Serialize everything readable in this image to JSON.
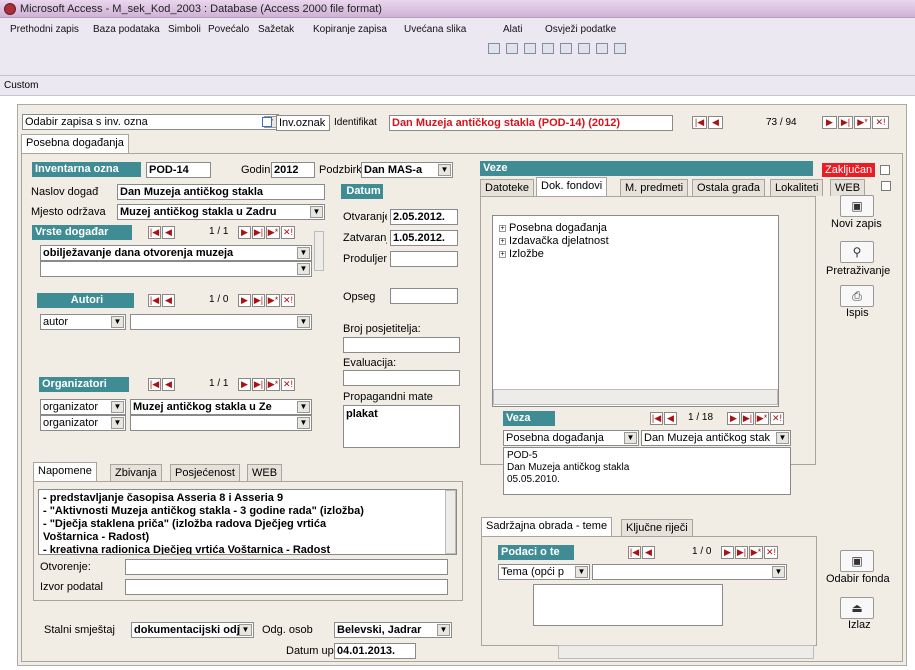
{
  "window": {
    "title": "Microsoft Access - M_sek_Kod_2003 : Database (Access 2000 file format)"
  },
  "menu": {
    "items": [
      "Prethodni zapis",
      "Baza podataka",
      "Simboli",
      "Povećalo",
      "Sažetak",
      "Kopiranje zapisa",
      "Uvećana slika",
      "Alati",
      "Osvježi podatke"
    ]
  },
  "toolbar": {
    "custom_label": "Custom"
  },
  "topbar": {
    "combo_value": "Odabir zapisa s inv. ozna",
    "inv_label": "Inv.oznak",
    "ident_label": "Identifikat",
    "ident_value": "Dan Muzeja antičkog stakla (POD-14) (2012)",
    "record_counter": "73 / 94"
  },
  "main_tab": "Posebna događanja",
  "left": {
    "inv_label": "Inventarna ozna",
    "inv_value": "POD-14",
    "godina_label": "Godin",
    "godina_value": "2012",
    "podzbirka_label": "Podzbirk",
    "podzbirka_value": "Dan MAS-a",
    "naslov_label": "Naslov događ",
    "naslov_value": "Dan Muzeja antičkog stakla",
    "mjesto_label": "Mjesto održava",
    "mjesto_value": "Muzej antičkog stakla u Zadru",
    "vrste_header": "Vrste događar",
    "vrste_counter": "1 / 1",
    "vrste_value": "obilježavanje dana otvorenja muzeja",
    "autori_header": "Autori",
    "autori_counter": "1 / 0",
    "autor_role": "autor",
    "org_header": "Organizatori",
    "org_counter": "1 / 1",
    "org_rows": [
      {
        "role": "organizator",
        "value": "Muzej antičkog stakla u Ze"
      },
      {
        "role": "organizator",
        "value": ""
      }
    ]
  },
  "datum": {
    "header": "Datum",
    "otvaranje_label": "Otvaranje",
    "otvaranje_value": "2.05.2012.",
    "zatvaranje_label": "Zatvaranj",
    "zatvaranje_value": "1.05.2012.",
    "produljen_label": "Produljen",
    "opseg_label": "Opseg",
    "broj_label": "Broj posjetitelja:",
    "evaluacija_label": "Evaluacija:",
    "propag_label": "Propagandni mate",
    "propag_value": "plakat"
  },
  "bottom_tabs": [
    "Napomene",
    "Zbivanja",
    "Posjećenost",
    "WEB"
  ],
  "napomene": {
    "lines": [
      "- predstavljanje časopisa Asseria 8 i Asseria 9",
      "- \"Aktivnosti Muzeja antičkog stakla - 3 godine rada\" (izložba)",
      "- \"Dječja staklena priča\" (izložba radova Dječjeg vrtića",
      "Voštarnica - Radost)",
      "- kreativna radionica Dječjeg vrtića Voštarnica - Radost"
    ],
    "otvorenje_label": "Otvorenje:",
    "izvor_label": "Izvor podatal"
  },
  "footer": {
    "smjestaj_label": "Stalni smještaj",
    "smjestaj_value": "dokumentacijski odje",
    "odg_label": "Odg. osob",
    "odg_value": "Belevski, Jadrar",
    "datum_label": "Datum upis",
    "datum_value": "04.01.2013."
  },
  "veze": {
    "header": "Veze",
    "zakljucan": "Zaključan",
    "tabs": [
      "Datoteke",
      "Dok. fondovi",
      "M. predmeti",
      "Ostala građa",
      "Lokaliteti",
      "WEB"
    ],
    "tree": [
      "Posebna događanja",
      "Izdavačka djelatnost",
      "Izložbe"
    ],
    "veza_header": "Veza",
    "veza_counter": "1 / 18",
    "veza_combo1": "Posebna događanja",
    "veza_combo2": "Dan Muzeja antičkog stak",
    "veza_lines": [
      "POD-5",
      "Dan Muzeja antičkog stakla",
      "05.05.2010."
    ]
  },
  "side_buttons": {
    "novi": "Novi zapis",
    "pretrazivanje": "Pretraživanje",
    "ispis": "Ispis",
    "odabir": "Odabir fonda",
    "izlaz": "Izlaz"
  },
  "sadrzaj": {
    "tabs": [
      "Sadržajna obrada - teme",
      "Ključne riječi"
    ],
    "header": "Podaci o te",
    "counter": "1 / 0",
    "tema_label": "Tema (opći p"
  },
  "colors": {
    "accent": "#3f8c95",
    "red": "#d3141c"
  }
}
